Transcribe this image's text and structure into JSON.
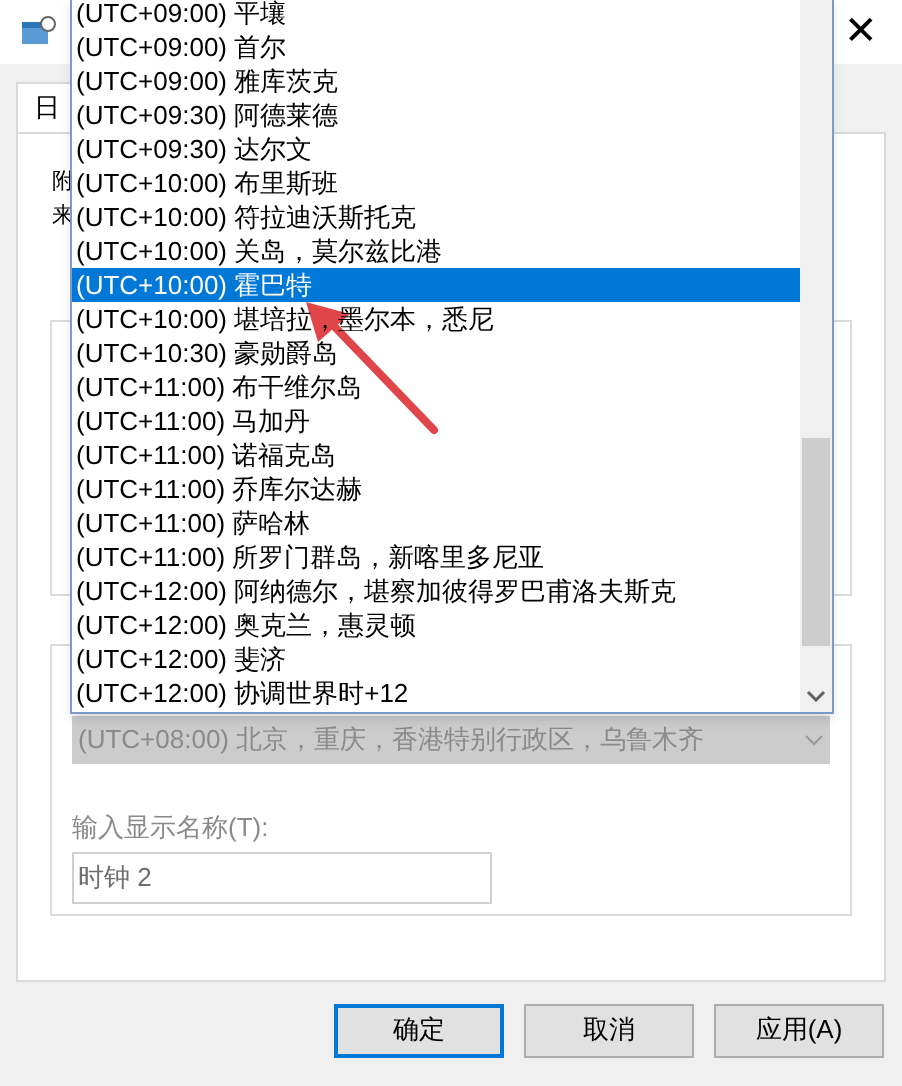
{
  "window": {
    "close_glyph": "✕"
  },
  "tab": {
    "label": "日",
    "selected": true
  },
  "description": {
    "line_1": "附",
    "line_2": "来"
  },
  "timezone_list": {
    "items": [
      {
        "label": "(UTC+09:00) 平壤",
        "selected": false
      },
      {
        "label": "(UTC+09:00) 首尔",
        "selected": false
      },
      {
        "label": "(UTC+09:00) 雅库茨克",
        "selected": false
      },
      {
        "label": "(UTC+09:30) 阿德莱德",
        "selected": false
      },
      {
        "label": "(UTC+09:30) 达尔文",
        "selected": false
      },
      {
        "label": "(UTC+10:00) 布里斯班",
        "selected": false
      },
      {
        "label": "(UTC+10:00) 符拉迪沃斯托克",
        "selected": false
      },
      {
        "label": "(UTC+10:00) 关岛，莫尔兹比港",
        "selected": false
      },
      {
        "label": "(UTC+10:00) 霍巴特",
        "selected": true
      },
      {
        "label": "(UTC+10:00) 堪培拉，墨尔本，悉尼",
        "selected": false
      },
      {
        "label": "(UTC+10:30) 豪勋爵岛",
        "selected": false
      },
      {
        "label": "(UTC+11:00) 布干维尔岛",
        "selected": false
      },
      {
        "label": "(UTC+11:00) 马加丹",
        "selected": false
      },
      {
        "label": "(UTC+11:00) 诺福克岛",
        "selected": false
      },
      {
        "label": "(UTC+11:00) 乔库尔达赫",
        "selected": false
      },
      {
        "label": "(UTC+11:00) 萨哈林",
        "selected": false
      },
      {
        "label": "(UTC+11:00) 所罗门群岛，新喀里多尼亚",
        "selected": false
      },
      {
        "label": "(UTC+12:00) 阿纳德尔，堪察加彼得罗巴甫洛夫斯克",
        "selected": false
      },
      {
        "label": "(UTC+12:00) 奥克兰，惠灵顿",
        "selected": false
      },
      {
        "label": "(UTC+12:00) 斐济",
        "selected": false
      },
      {
        "label": "(UTC+12:00) 协调世界时+12",
        "selected": false
      }
    ]
  },
  "second_clock": {
    "timezone": "(UTC+08:00) 北京，重庆，香港特别行政区，乌鲁木齐",
    "disabled": true,
    "name_label": "输入显示名称(T):",
    "name_value": "时钟 2"
  },
  "buttons": [
    {
      "label": "确定",
      "default": true
    },
    {
      "label": "取消",
      "default": false
    },
    {
      "label": "应用(A)",
      "default": false
    }
  ]
}
